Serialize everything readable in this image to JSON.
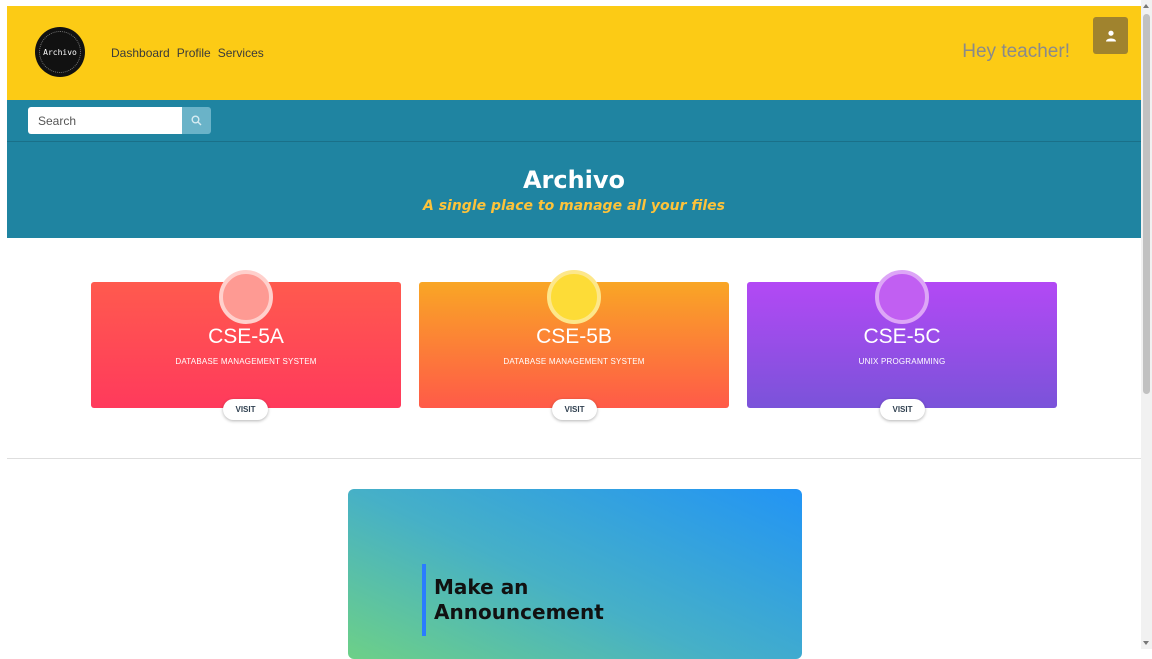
{
  "header": {
    "logo_text": "Archivo",
    "nav": [
      "Dashboard",
      "Profile",
      "Services"
    ],
    "greeting": "Hey teacher!",
    "user_icon": "user-icon"
  },
  "search": {
    "placeholder": "Search",
    "icon": "search-icon"
  },
  "hero": {
    "title": "Archivo",
    "subtitle": "A single place to manage all your files"
  },
  "cards": [
    {
      "code": "CSE-5A",
      "subject": "DATABASE MANAGEMENT SYSTEM",
      "button": "VISIT"
    },
    {
      "code": "CSE-5B",
      "subject": "DATABASE MANAGEMENT SYSTEM",
      "button": "VISIT"
    },
    {
      "code": "CSE-5C",
      "subject": "UNIX PROGRAMMING",
      "button": "VISIT"
    }
  ],
  "announcement": {
    "title": "Make an Announcement"
  },
  "colors": {
    "header": "#fccb15",
    "bar": "#1f84a1",
    "subtitle": "#fdc33a"
  }
}
